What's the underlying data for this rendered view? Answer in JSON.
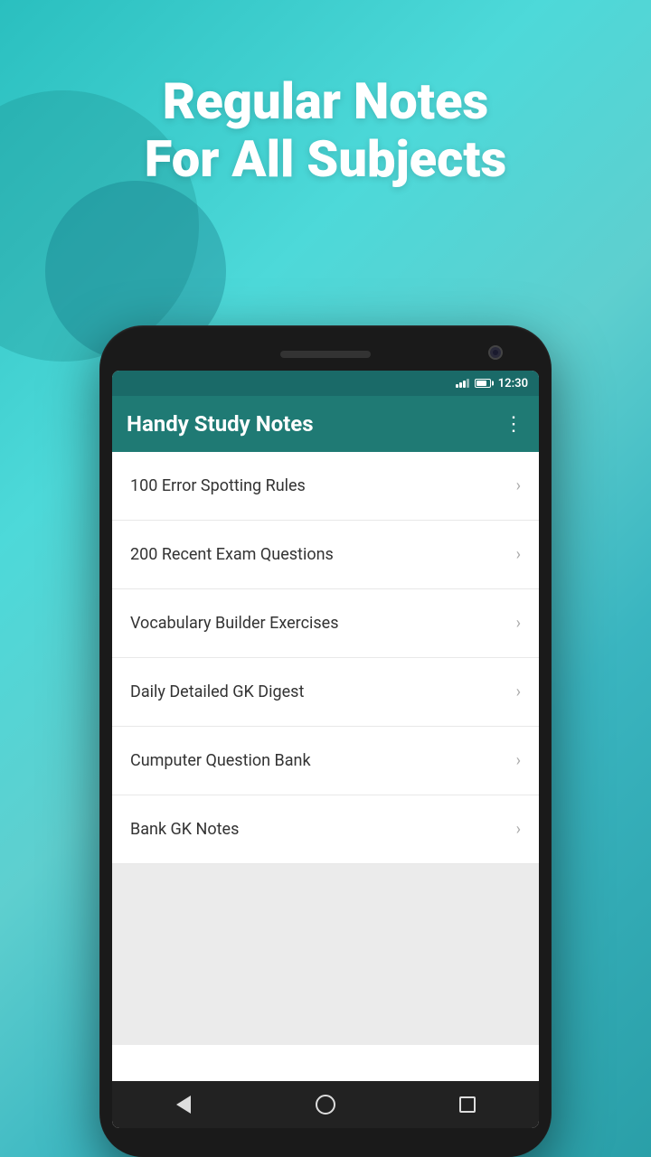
{
  "background": {
    "gradient_start": "#2abfbf",
    "gradient_end": "#2a9fa8"
  },
  "headline": {
    "line1": "Regular Notes",
    "line2": "For All Subjects"
  },
  "status_bar": {
    "time": "12:30"
  },
  "toolbar": {
    "title": "Handy Study Notes",
    "menu_icon": "⋮"
  },
  "list_items": [
    {
      "id": 1,
      "label": "100 Error Spotting Rules"
    },
    {
      "id": 2,
      "label": "200 Recent Exam Questions"
    },
    {
      "id": 3,
      "label": "Vocabulary Builder Exercises"
    },
    {
      "id": 4,
      "label": "Daily Detailed GK  Digest"
    },
    {
      "id": 5,
      "label": "Cumputer Question Bank"
    },
    {
      "id": 6,
      "label": "Bank GK Notes"
    }
  ],
  "nav": {
    "back_label": "back",
    "home_label": "home",
    "recents_label": "recents"
  }
}
